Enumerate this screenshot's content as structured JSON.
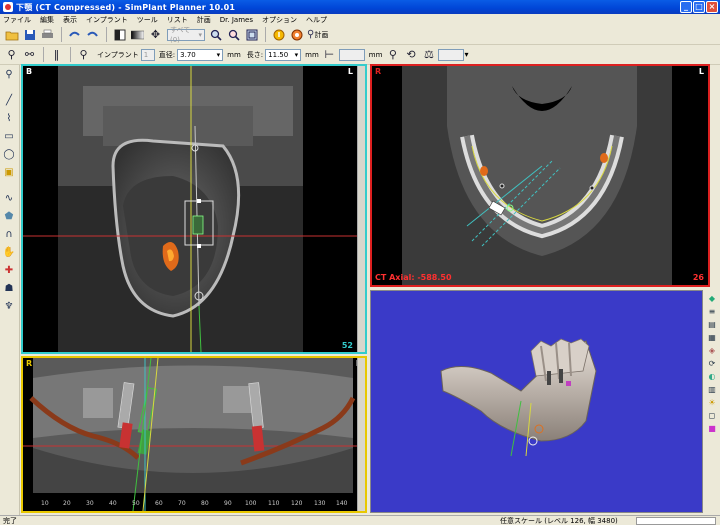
{
  "window": {
    "title": "下顎 (CT Compressed) - SimPlant Planner 10.01",
    "buttons": {
      "minimize": "_",
      "maximize": "□",
      "close": "×"
    }
  },
  "menu": [
    "ファイル",
    "編集",
    "表示",
    "インプラント",
    "ツール",
    "リスト",
    "計画",
    "Dr. James",
    "オプション",
    "ヘルプ"
  ],
  "toolbar1": {
    "dropdown_value": "すべて(0)",
    "plan_label": "計画"
  },
  "toolbar2": {
    "implant_label": "インプラント",
    "implant_value": "1",
    "diameter_label": "直径:",
    "diameter_value": "3.70",
    "diameter_unit": "mm",
    "length_label": "長さ:",
    "length_value": "11.50",
    "length_unit": "mm",
    "extra_unit": "mm"
  },
  "views": {
    "cross_section": {
      "orient_left": "B",
      "orient_right": "L",
      "slice_number": "52"
    },
    "axial": {
      "orient_left": "R",
      "orient_right": "L",
      "label": "CT Axial: -588.50",
      "slice_number": "26"
    },
    "panoramic": {
      "orient_left": "R",
      "orient_right": "L",
      "ruler_ticks": [
        "10",
        "20",
        "30",
        "40",
        "50",
        "60",
        "70",
        "80",
        "90",
        "100",
        "110",
        "120",
        "130",
        "140"
      ]
    },
    "volume_3d": {}
  },
  "status": {
    "text": "完了",
    "scale": "任意スケール (レベル 126, 幅 3480)"
  },
  "colors": {
    "cross_border": "#33cccc",
    "axial_border": "#dd2020",
    "pano_border": "#e8c800",
    "volume_bg": "#3a3ac8"
  }
}
